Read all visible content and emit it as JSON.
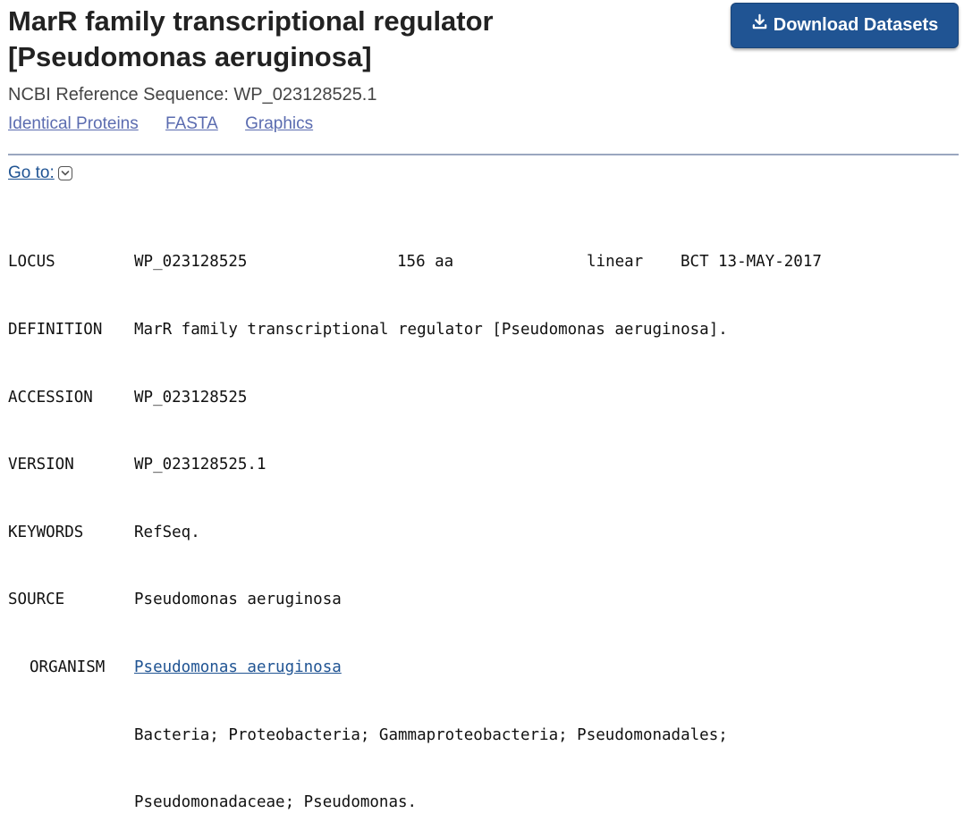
{
  "header": {
    "title_line1": "MarR family transcriptional regulator",
    "title_line2": "[Pseudomonas aeruginosa]",
    "download_label": "Download Datasets",
    "refseq_text": "NCBI Reference Sequence: WP_023128525.1"
  },
  "links": [
    "Identical Proteins",
    "FASTA",
    "Graphics"
  ],
  "goto_label": "Go to:",
  "genbank": {
    "locus": {
      "key": "LOCUS",
      "name": "WP_023128525",
      "length": "156 aa",
      "topology": "linear",
      "division": "BCT",
      "date": "13-MAY-2017"
    },
    "definition": {
      "key": "DEFINITION",
      "value": "MarR family transcriptional regulator [Pseudomonas aeruginosa]."
    },
    "accession": {
      "key": "ACCESSION",
      "value": "WP_023128525"
    },
    "version": {
      "key": "VERSION",
      "value": "WP_023128525.1"
    },
    "keywords": {
      "key": "KEYWORDS",
      "value": "RefSeq."
    },
    "source": {
      "key": "SOURCE",
      "value": "Pseudomonas aeruginosa"
    },
    "organism": {
      "key": "ORGANISM",
      "link": "Pseudomonas aeruginosa",
      "lineage1": "Bacteria; Proteobacteria; Gammaproteobacteria; Pseudomonadales;",
      "lineage2": "Pseudomonadaceae; Pseudomonas."
    }
  },
  "colors": {
    "button": "#205493",
    "link": "#5b6cb0",
    "rule": "#9aa6bf"
  },
  "icons": {
    "download": "download-icon",
    "goto": "chevron-down-icon"
  }
}
